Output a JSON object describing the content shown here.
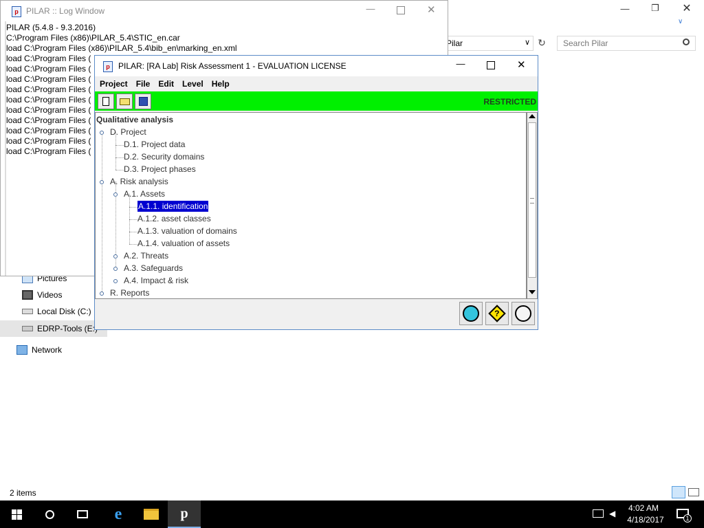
{
  "explorer": {
    "address_value": "Pilar",
    "search_placeholder": "Search Pilar",
    "nav": {
      "pictures": "Pictures",
      "videos": "Videos",
      "local_disk": "Local Disk (C:)",
      "edrp_tools": "EDRP-Tools (E:)",
      "network": "Network"
    },
    "status": "2 items"
  },
  "log_window": {
    "title": "PILAR :: Log Window",
    "lines": [
      "PILAR (5.4.8 - 9.3.2016)",
      "C:\\Program Files (x86)\\PILAR_5.4\\STIC_en.car",
      "load C:\\Program Files (x86)\\PILAR_5.4\\bib_en\\marking_en.xml",
      "load C:\\Program Files (",
      "load C:\\Program Files (",
      "load C:\\Program Files (",
      "load C:\\Program Files (",
      "load C:\\Program Files (",
      "load C:\\Program Files (",
      "load C:\\Program Files (",
      "load C:\\Program Files (",
      "load C:\\Program Files (",
      "load C:\\Program Files ("
    ]
  },
  "pilar": {
    "title": "PILAR: [RA Lab] Risk Assessment 1 - EVALUATION LICENSE",
    "menu": [
      "Project",
      "File",
      "Edit",
      "Level",
      "Help"
    ],
    "restricted": "RESTRICTED",
    "tree": {
      "root": "Qualitative analysis",
      "project": "D. Project",
      "d1": "D.1. Project data",
      "d2": "D.2. Security domains",
      "d3": "D.3. Project phases",
      "risk": "A. Risk analysis",
      "assets": "A.1. Assets",
      "a11": "A.1.1. identification",
      "a12": "A.1.2. asset classes",
      "a13": "A.1.3. valuation of domains",
      "a14": "A.1.4. valuation of assets",
      "threats": "A.2. Threats",
      "safeguards": "A.3. Safeguards",
      "impact": "A.4. Impact & risk",
      "reports": "R. Reports"
    },
    "colors": {
      "toolbar": "#00f000",
      "selection": "#0000d0"
    }
  },
  "taskbar": {
    "time": "4:02 AM",
    "date": "4/18/2017",
    "notification_count": "1"
  }
}
